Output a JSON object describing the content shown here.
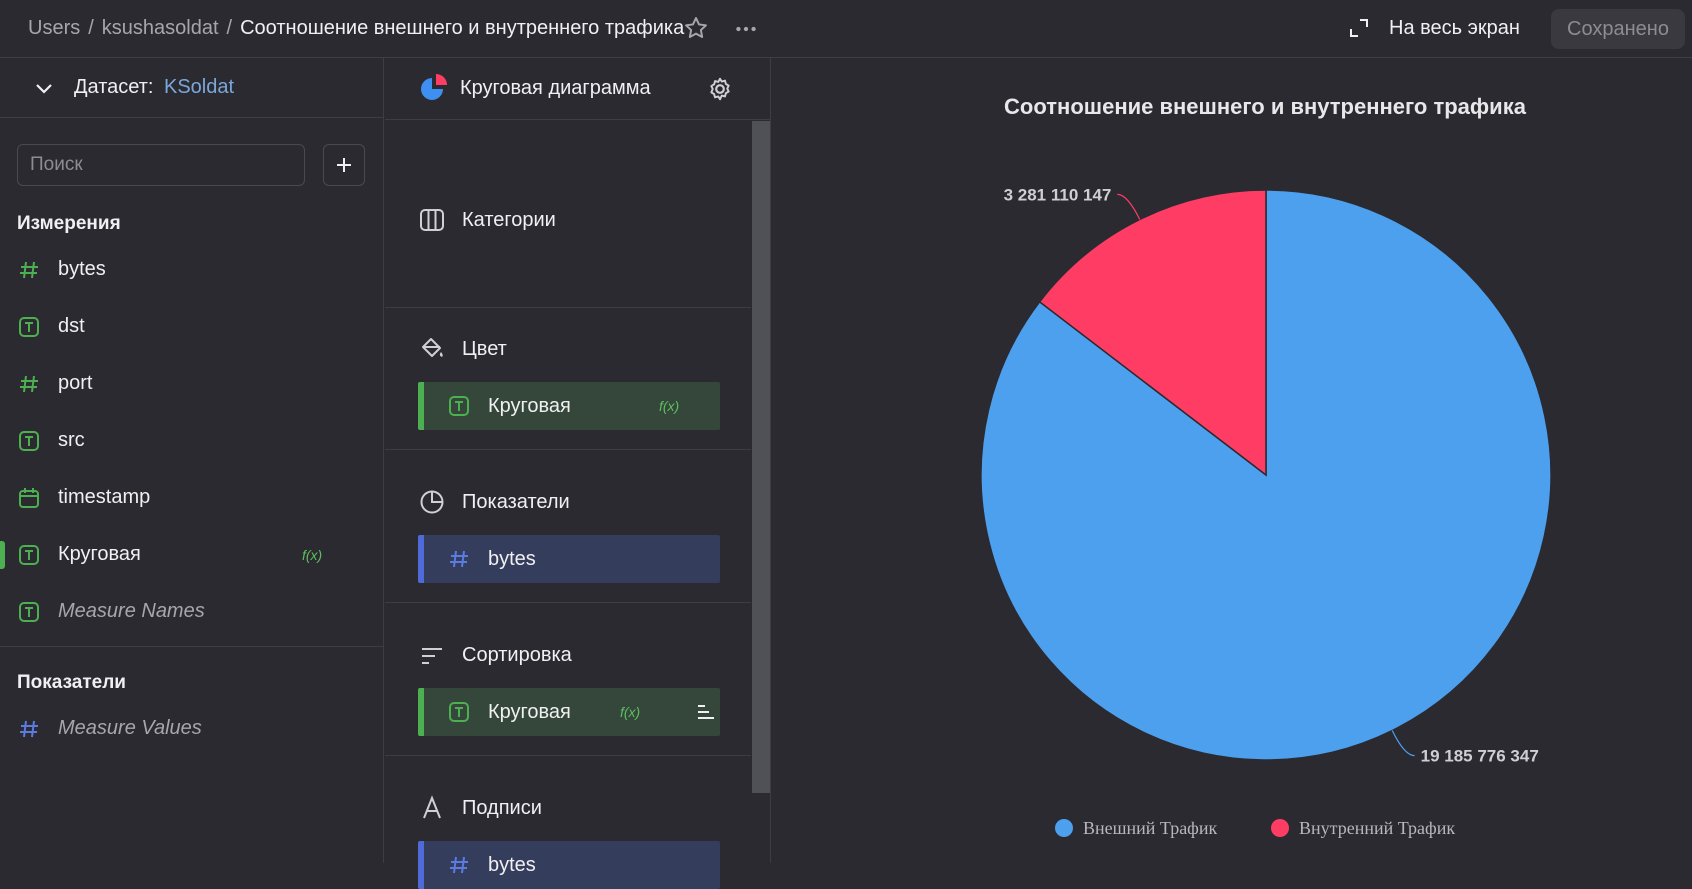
{
  "breadcrumb": {
    "root": "Users",
    "user": "ksushasoldat",
    "current": "Соотношение внешнего и внутреннего трафика"
  },
  "header": {
    "fullscreen_label": "На весь экран",
    "saved_label": "Сохранено"
  },
  "dataset": {
    "label": "Датасет:",
    "name": "KSoldat"
  },
  "search": {
    "placeholder": "Поиск"
  },
  "dimensions": {
    "title": "Измерения",
    "items": [
      {
        "label": "bytes",
        "icon": "hash-icon"
      },
      {
        "label": "dst",
        "icon": "text-field-icon"
      },
      {
        "label": "port",
        "icon": "hash-icon"
      },
      {
        "label": "src",
        "icon": "text-field-icon"
      },
      {
        "label": "timestamp",
        "icon": "calendar-icon"
      },
      {
        "label": "Круговая",
        "icon": "text-field-icon",
        "fx": "f(x)"
      },
      {
        "label": "Measure Names",
        "icon": "text-field-icon"
      }
    ]
  },
  "measures": {
    "title": "Показатели",
    "items": [
      {
        "label": "Measure Values",
        "icon": "hash-icon"
      }
    ]
  },
  "visualization": {
    "title": "Круговая диаграмма",
    "sections": {
      "categories": "Категории",
      "color": "Цвет",
      "color_field": "Круговая",
      "measures": "Показатели",
      "measures_field": "bytes",
      "sort": "Сортировка",
      "sort_field": "Круговая",
      "labels": "Подписи",
      "labels_field": "bytes",
      "fx": "f(x)"
    }
  },
  "chart_data": {
    "type": "pie",
    "title": "Соотношение внешнего и внутреннего трафика",
    "slices": [
      {
        "name": "Внешний Трафик",
        "value": 19185776347,
        "label": "19 185 776 347",
        "color": "#4da0ee"
      },
      {
        "name": "Внутренний Трафик",
        "value": 3281110147,
        "label": "3 281 110 147",
        "color": "#ff3d64"
      }
    ],
    "legend_position": "bottom"
  }
}
